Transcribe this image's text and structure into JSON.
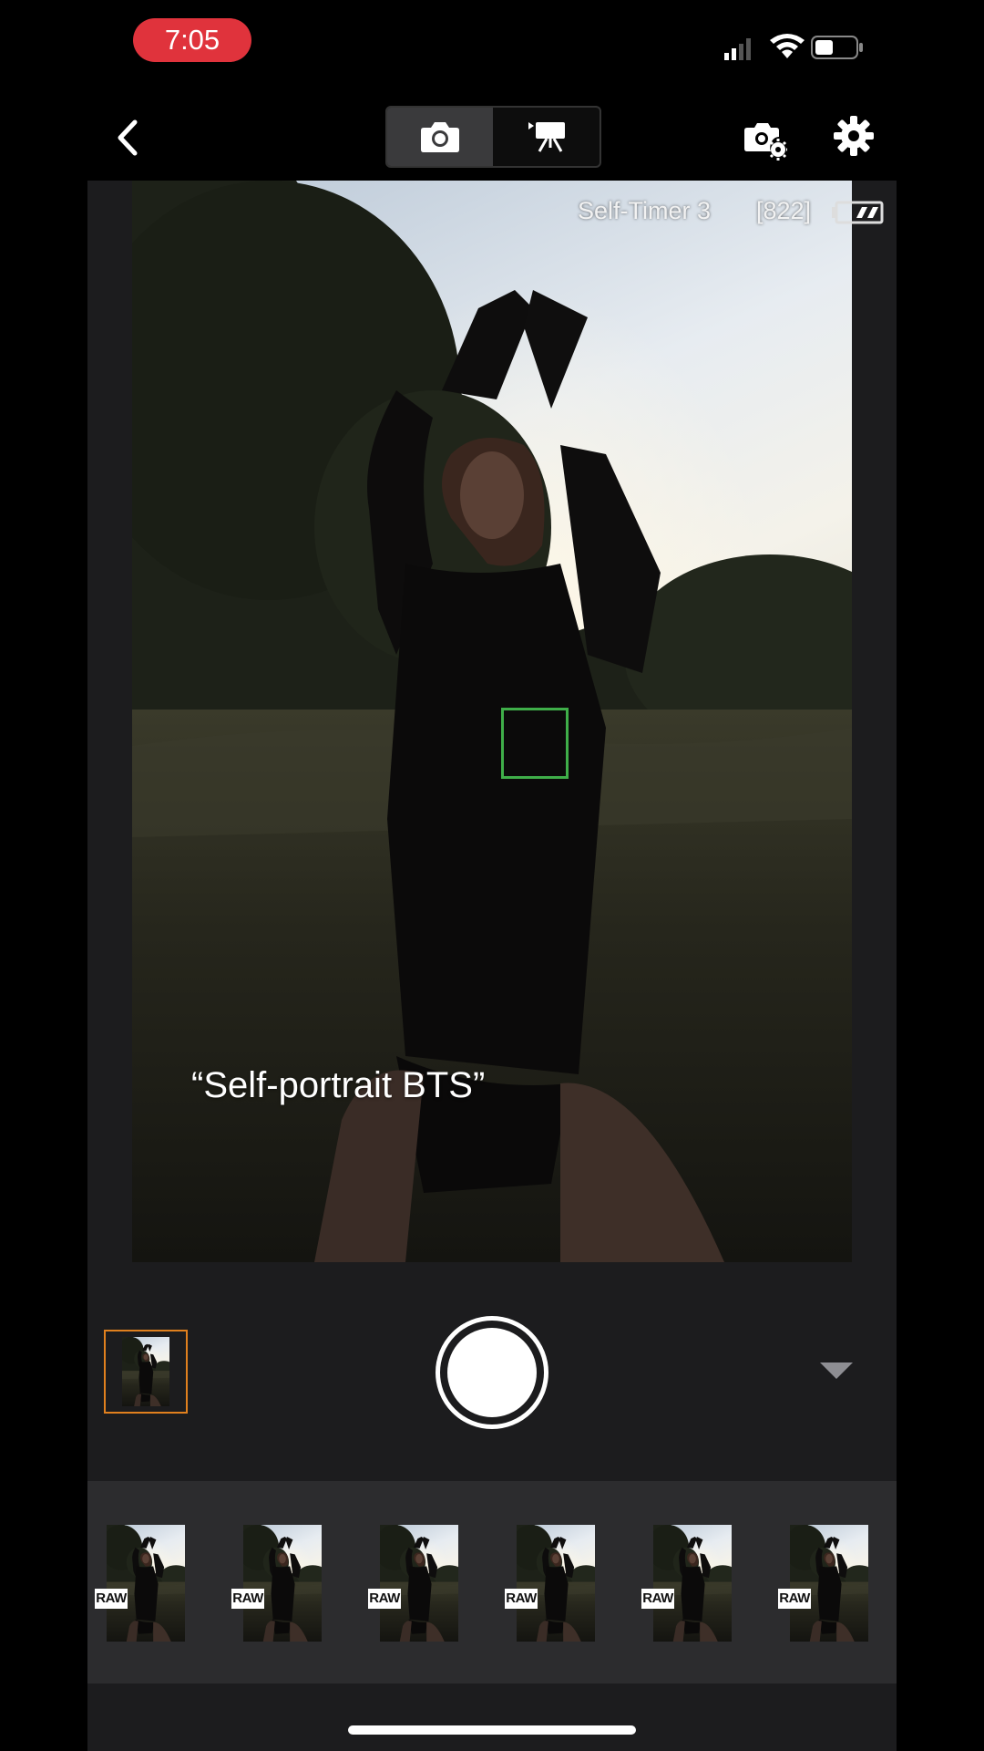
{
  "status_bar": {
    "time": "7:05",
    "time_pill_color": "#e0333c",
    "signal_icon": "cellular-signal-icon",
    "wifi_icon": "wifi-icon",
    "battery_icon": "battery-icon"
  },
  "toolbar": {
    "back_icon": "chevron-left-icon",
    "modes": [
      {
        "name": "photo",
        "icon": "camera-icon",
        "selected": true
      },
      {
        "name": "video",
        "icon": "video-camera-icon",
        "selected": false
      }
    ],
    "camera_settings_icon": "camera-gear-icon",
    "settings_icon": "gear-icon"
  },
  "liveview": {
    "osd_timer": "Self-Timer 3",
    "osd_shots": "[822]",
    "osd_battery_icon": "camera-battery-icon",
    "af_box_color": "#3fae49",
    "caption": "“Self-portrait BTS”"
  },
  "controls": {
    "last_shot_border_color": "#e0801e",
    "shutter_icon": "shutter-button",
    "expand_icon": "triangle-down-icon"
  },
  "filmstrip": {
    "items": [
      {
        "badge": "RAW"
      },
      {
        "badge": "RAW"
      },
      {
        "badge": "RAW"
      },
      {
        "badge": "RAW"
      },
      {
        "badge": "RAW"
      },
      {
        "badge": "RAW"
      }
    ]
  }
}
